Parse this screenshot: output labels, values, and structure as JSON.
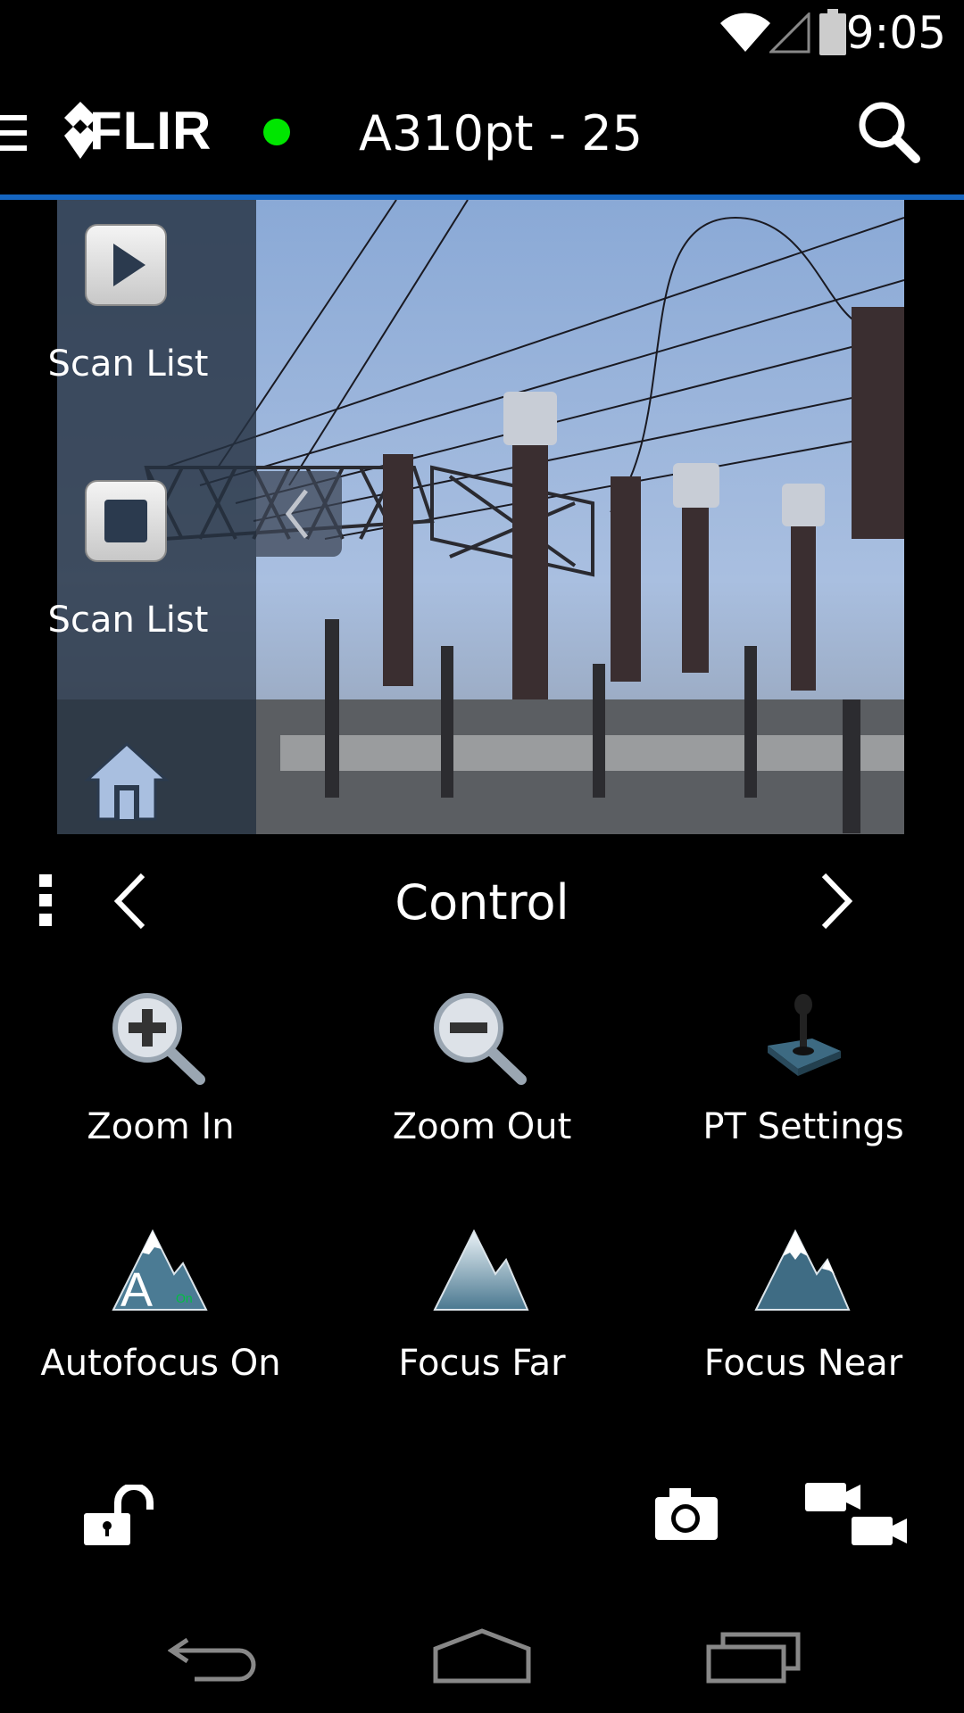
{
  "status_bar": {
    "time": "9:05",
    "icons": [
      "wifi-icon",
      "signal-icon",
      "battery-icon"
    ]
  },
  "action_bar": {
    "logo_text": "FLIR",
    "connection_status_color": "#00e600",
    "camera_title": "A310pt - 25",
    "accent_color": "#1565c0"
  },
  "video_panel": {
    "side_buttons": [
      {
        "icon": "play-icon",
        "label": "Scan List"
      },
      {
        "icon": "stop-icon",
        "label": "Scan List"
      },
      {
        "icon": "home-icon",
        "label": ""
      }
    ]
  },
  "control_nav": {
    "title": "Control"
  },
  "controls": [
    {
      "icon": "zoom-in-icon",
      "label": "Zoom In"
    },
    {
      "icon": "zoom-out-icon",
      "label": "Zoom Out"
    },
    {
      "icon": "joystick-icon",
      "label": "PT Settings"
    },
    {
      "icon": "autofocus-icon",
      "label": "Autofocus On"
    },
    {
      "icon": "focus-far-icon",
      "label": "Focus Far"
    },
    {
      "icon": "focus-near-icon",
      "label": "Focus Near"
    }
  ],
  "bottom_toolbar": [
    "unlock-icon",
    "camera-icon",
    "video-camera-icon"
  ],
  "system_nav": [
    "back-icon",
    "home-icon",
    "recents-icon"
  ]
}
